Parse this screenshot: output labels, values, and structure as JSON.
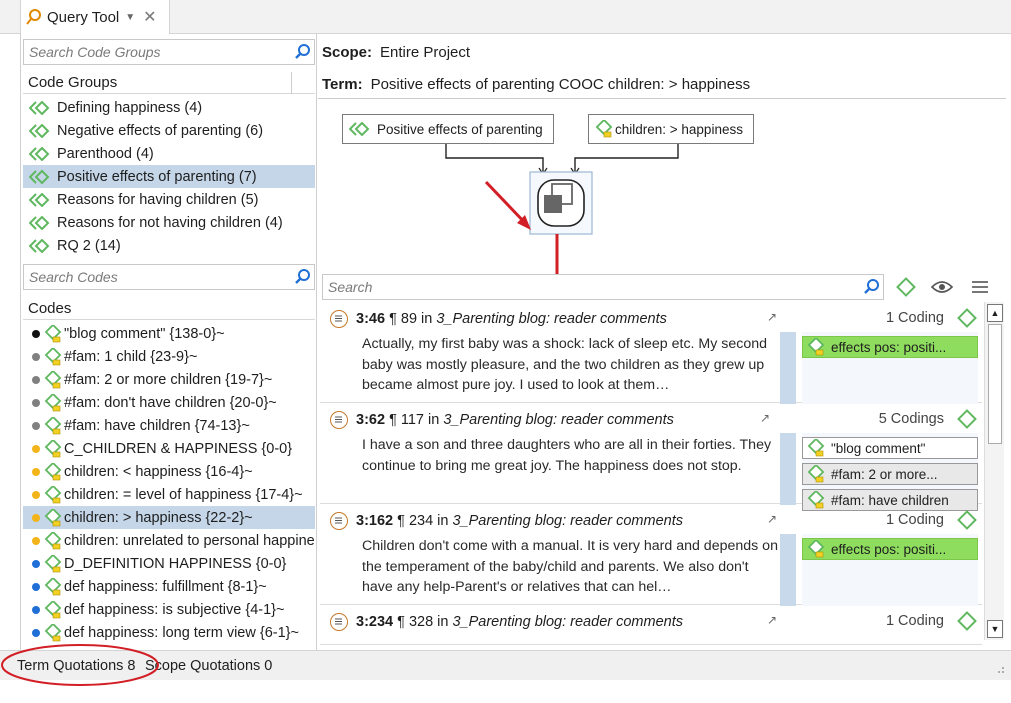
{
  "tab": {
    "title": "Query Tool",
    "dropdown_glyph": "▼",
    "close_glyph": "✕"
  },
  "left": {
    "search_groups_placeholder": "Search Code Groups",
    "groups_header": "Code Groups",
    "groups": [
      "Defining happiness (4)",
      "Negative effects of parenting (6)",
      "Parenthood (4)",
      "Positive effects of parenting (7)",
      "Reasons for having children (5)",
      "Reasons for not having children (4)",
      "RQ 2 (14)"
    ],
    "search_codes_placeholder": "Search Codes",
    "codes_header": "Codes",
    "codes": [
      {
        "label": "\"blog comment\" {138-0}~",
        "color": "#111111"
      },
      {
        "label": "#fam: 1 child {23-9}~",
        "color": "#808080"
      },
      {
        "label": "#fam: 2 or more  children {19-7}~",
        "color": "#808080"
      },
      {
        "label": "#fam: don't have children {20-0}~",
        "color": "#808080"
      },
      {
        "label": "#fam: have children {74-13}~",
        "color": "#808080"
      },
      {
        "label": "C_CHILDREN & HAPPINESS {0-0}",
        "color": "#f2b418"
      },
      {
        "label": "children: < happiness {16-4}~",
        "color": "#f2b418"
      },
      {
        "label": "children: = level of happiness {17-4}~",
        "color": "#f2b418"
      },
      {
        "label": "children: > happiness {22-2}~",
        "color": "#f2b418"
      },
      {
        "label": "children: unrelated to personal happiness",
        "color": "#f2b418"
      },
      {
        "label": "D_DEFINITION HAPPINESS {0-0}",
        "color": "#1f6fd6"
      },
      {
        "label": "def happiness: fulfillment {8-1}~",
        "color": "#1f6fd6"
      },
      {
        "label": "def happiness: is subjective {4-1}~",
        "color": "#1f6fd6"
      },
      {
        "label": "def happiness: long term view {6-1}~",
        "color": "#1f6fd6"
      }
    ]
  },
  "right": {
    "scope_label": "Scope:",
    "scope_value": "Entire Project",
    "term_label": "Term:",
    "term_value": "Positive effects of parenting COOC children: > happiness",
    "node_left": "Positive effects of parenting",
    "node_right": "children: > happiness",
    "search_placeholder": "Search",
    "quotes": [
      {
        "id": "3:46",
        "para": "¶ 89",
        "in": "in",
        "source": "3_Parenting blog: reader comments",
        "count": "1 Coding",
        "text": "Actually, my first baby was a shock: lack of sleep etc. My second baby was mostly pleasure, and the two children as they grew up became almost pure joy. I used to look at them…",
        "chips": [
          "effects pos: positi..."
        ]
      },
      {
        "id": "3:62",
        "para": "¶ 117",
        "in": "in",
        "source": "3_Parenting blog: reader comments",
        "count": "5 Codings",
        "text": "I have a son and three daughters who are all in their forties. They continue to bring me great joy. The happiness does not stop.",
        "chips": [
          "\"blog comment\"",
          "#fam: 2 or more...",
          "#fam: have children"
        ]
      },
      {
        "id": "3:162",
        "para": "¶ 234",
        "in": "in",
        "source": "3_Parenting blog: reader comments",
        "count": "1 Coding",
        "text": "Children don't come with a manual. It is very hard and depends on the temperament of the baby/child and parents. We also don't have any help-Parent's or relatives that can hel…",
        "chips": [
          "effects pos: positi..."
        ]
      },
      {
        "id": "3:234",
        "para": "¶ 328",
        "in": "in",
        "source": "3_Parenting blog: reader comments",
        "count": "1 Coding",
        "text": "",
        "chips": []
      }
    ]
  },
  "status": {
    "term_quotations": "Term Quotations 8",
    "scope_quotations": "Scope Quotations 0"
  },
  "colors": {
    "accent_green": "#5fb85f",
    "selection": "#c5d6e8",
    "chip_green": "#8fdd5e",
    "arrow_red": "#d21f26"
  }
}
